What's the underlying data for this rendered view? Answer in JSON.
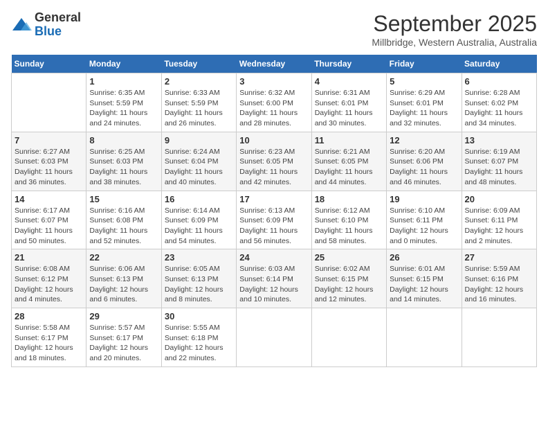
{
  "header": {
    "logo_general": "General",
    "logo_blue": "Blue",
    "month_title": "September 2025",
    "location": "Millbridge, Western Australia, Australia"
  },
  "days_of_week": [
    "Sunday",
    "Monday",
    "Tuesday",
    "Wednesday",
    "Thursday",
    "Friday",
    "Saturday"
  ],
  "weeks": [
    [
      {
        "day": "",
        "content": ""
      },
      {
        "day": "1",
        "content": "Sunrise: 6:35 AM\nSunset: 5:59 PM\nDaylight: 11 hours\nand 24 minutes."
      },
      {
        "day": "2",
        "content": "Sunrise: 6:33 AM\nSunset: 5:59 PM\nDaylight: 11 hours\nand 26 minutes."
      },
      {
        "day": "3",
        "content": "Sunrise: 6:32 AM\nSunset: 6:00 PM\nDaylight: 11 hours\nand 28 minutes."
      },
      {
        "day": "4",
        "content": "Sunrise: 6:31 AM\nSunset: 6:01 PM\nDaylight: 11 hours\nand 30 minutes."
      },
      {
        "day": "5",
        "content": "Sunrise: 6:29 AM\nSunset: 6:01 PM\nDaylight: 11 hours\nand 32 minutes."
      },
      {
        "day": "6",
        "content": "Sunrise: 6:28 AM\nSunset: 6:02 PM\nDaylight: 11 hours\nand 34 minutes."
      }
    ],
    [
      {
        "day": "7",
        "content": "Sunrise: 6:27 AM\nSunset: 6:03 PM\nDaylight: 11 hours\nand 36 minutes."
      },
      {
        "day": "8",
        "content": "Sunrise: 6:25 AM\nSunset: 6:03 PM\nDaylight: 11 hours\nand 38 minutes."
      },
      {
        "day": "9",
        "content": "Sunrise: 6:24 AM\nSunset: 6:04 PM\nDaylight: 11 hours\nand 40 minutes."
      },
      {
        "day": "10",
        "content": "Sunrise: 6:23 AM\nSunset: 6:05 PM\nDaylight: 11 hours\nand 42 minutes."
      },
      {
        "day": "11",
        "content": "Sunrise: 6:21 AM\nSunset: 6:05 PM\nDaylight: 11 hours\nand 44 minutes."
      },
      {
        "day": "12",
        "content": "Sunrise: 6:20 AM\nSunset: 6:06 PM\nDaylight: 11 hours\nand 46 minutes."
      },
      {
        "day": "13",
        "content": "Sunrise: 6:19 AM\nSunset: 6:07 PM\nDaylight: 11 hours\nand 48 minutes."
      }
    ],
    [
      {
        "day": "14",
        "content": "Sunrise: 6:17 AM\nSunset: 6:07 PM\nDaylight: 11 hours\nand 50 minutes."
      },
      {
        "day": "15",
        "content": "Sunrise: 6:16 AM\nSunset: 6:08 PM\nDaylight: 11 hours\nand 52 minutes."
      },
      {
        "day": "16",
        "content": "Sunrise: 6:14 AM\nSunset: 6:09 PM\nDaylight: 11 hours\nand 54 minutes."
      },
      {
        "day": "17",
        "content": "Sunrise: 6:13 AM\nSunset: 6:09 PM\nDaylight: 11 hours\nand 56 minutes."
      },
      {
        "day": "18",
        "content": "Sunrise: 6:12 AM\nSunset: 6:10 PM\nDaylight: 11 hours\nand 58 minutes."
      },
      {
        "day": "19",
        "content": "Sunrise: 6:10 AM\nSunset: 6:11 PM\nDaylight: 12 hours\nand 0 minutes."
      },
      {
        "day": "20",
        "content": "Sunrise: 6:09 AM\nSunset: 6:11 PM\nDaylight: 12 hours\nand 2 minutes."
      }
    ],
    [
      {
        "day": "21",
        "content": "Sunrise: 6:08 AM\nSunset: 6:12 PM\nDaylight: 12 hours\nand 4 minutes."
      },
      {
        "day": "22",
        "content": "Sunrise: 6:06 AM\nSunset: 6:13 PM\nDaylight: 12 hours\nand 6 minutes."
      },
      {
        "day": "23",
        "content": "Sunrise: 6:05 AM\nSunset: 6:13 PM\nDaylight: 12 hours\nand 8 minutes."
      },
      {
        "day": "24",
        "content": "Sunrise: 6:03 AM\nSunset: 6:14 PM\nDaylight: 12 hours\nand 10 minutes."
      },
      {
        "day": "25",
        "content": "Sunrise: 6:02 AM\nSunset: 6:15 PM\nDaylight: 12 hours\nand 12 minutes."
      },
      {
        "day": "26",
        "content": "Sunrise: 6:01 AM\nSunset: 6:15 PM\nDaylight: 12 hours\nand 14 minutes."
      },
      {
        "day": "27",
        "content": "Sunrise: 5:59 AM\nSunset: 6:16 PM\nDaylight: 12 hours\nand 16 minutes."
      }
    ],
    [
      {
        "day": "28",
        "content": "Sunrise: 5:58 AM\nSunset: 6:17 PM\nDaylight: 12 hours\nand 18 minutes."
      },
      {
        "day": "29",
        "content": "Sunrise: 5:57 AM\nSunset: 6:17 PM\nDaylight: 12 hours\nand 20 minutes."
      },
      {
        "day": "30",
        "content": "Sunrise: 5:55 AM\nSunset: 6:18 PM\nDaylight: 12 hours\nand 22 minutes."
      },
      {
        "day": "",
        "content": ""
      },
      {
        "day": "",
        "content": ""
      },
      {
        "day": "",
        "content": ""
      },
      {
        "day": "",
        "content": ""
      }
    ]
  ]
}
